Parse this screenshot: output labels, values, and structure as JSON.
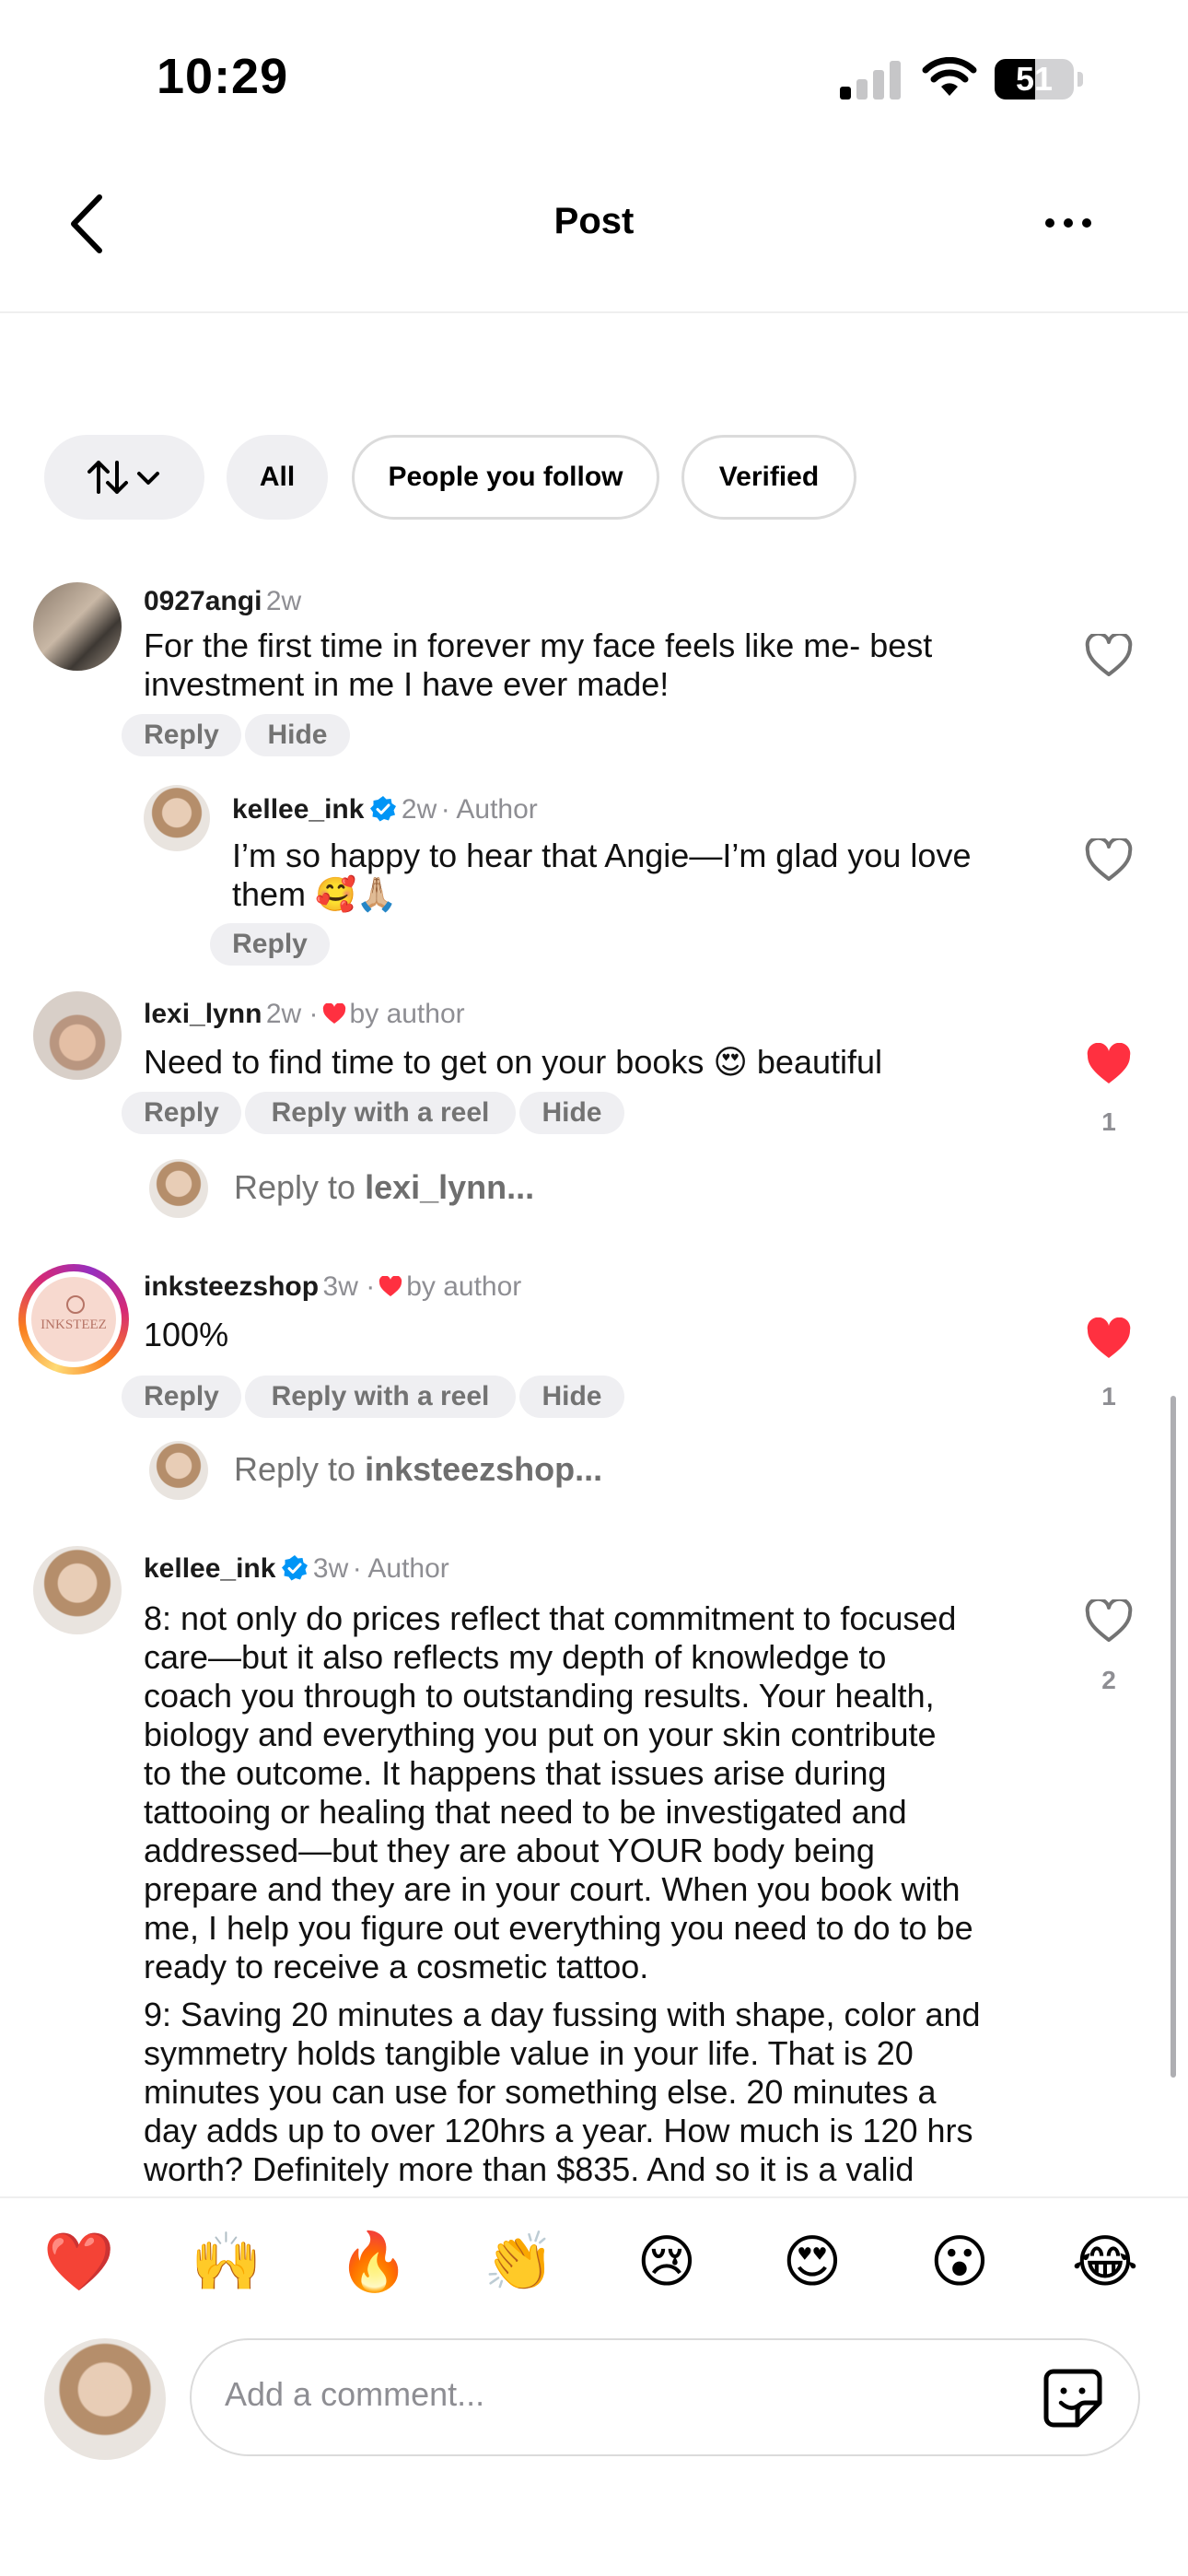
{
  "status_bar": {
    "time": "10:29",
    "battery": "51"
  },
  "header": {
    "title": "Post"
  },
  "filters": {
    "all": "All",
    "people_you_follow": "People you follow",
    "verified": "Verified"
  },
  "comments": [
    {
      "username": "0927angi",
      "time": "2w",
      "text": [
        "For the first time in forever my face feels like me- best",
        "investment in me I have ever made!"
      ],
      "actions": [
        "Reply",
        "Hide"
      ],
      "liked": false,
      "like_count": ""
    },
    {
      "username": "kellee_ink",
      "time": "2w",
      "author_label": "· Author",
      "text": [
        "I’m so happy to hear that Angie—I’m glad you love",
        "them 🥰🙏🏼"
      ],
      "actions": [
        "Reply"
      ],
      "liked": false,
      "like_count": ""
    },
    {
      "username": "lexi_lynn",
      "time": "2w ·",
      "by_author": "by author",
      "text": [
        "Need to find time to get on your books 😍 beautiful"
      ],
      "actions": [
        "Reply",
        "Reply with a reel",
        "Hide"
      ],
      "liked": true,
      "like_count": "1",
      "reply_prompt": "Reply to ",
      "reply_prompt_user": "lexi_lynn..."
    },
    {
      "username": "inksteezshop",
      "time": "3w ·",
      "by_author": "by author",
      "text": [
        "100%"
      ],
      "actions": [
        "Reply",
        "Reply with a reel",
        "Hide"
      ],
      "liked": true,
      "like_count": "1",
      "reply_prompt": "Reply to ",
      "reply_prompt_user": "inksteezshop..."
    },
    {
      "username": "kellee_ink",
      "time": "3w",
      "author_label": "· Author",
      "text": [
        "8: not only do prices reflect that commitment to focused",
        "care—but it also reflects my depth of knowledge to",
        "coach you through to outstanding results. Your health,",
        "biology and everything you put on your skin contribute",
        "to the outcome. It happens that issues arise during",
        "tattooing or healing that need to be investigated and",
        "addressed—but they are about YOUR body being",
        "prepare and they are in your court. When you book with",
        "me, I help you figure out everything you need to do to be",
        "ready to receive a cosmetic tattoo."
      ],
      "text2": [
        "9: Saving 20 minutes a day fussing with shape, color and",
        "symmetry holds tangible value in your life. That is 20",
        "minutes you can use for something else. 20 minutes a",
        "day adds up to over 120hrs a year. How much is 120 hrs",
        "worth? Definitely more than $835. And so it is a valid"
      ],
      "liked": false,
      "like_count": "2"
    }
  ],
  "emoji_bar": [
    "❤️",
    "🙌",
    "🔥",
    "👏",
    "😢",
    "😍",
    "😮",
    "😂"
  ],
  "composer": {
    "placeholder": "Add a comment..."
  },
  "colors": {
    "heart_red": "#ff3040",
    "verified_blue": "#0095f6",
    "chip_gray": "#efeff2"
  }
}
